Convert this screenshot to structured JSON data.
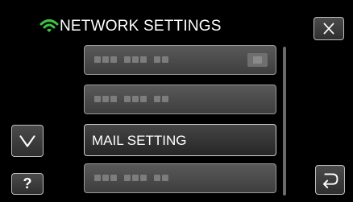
{
  "header": {
    "title": "NETWORK SETTINGS",
    "wifi_icon": "wifi-icon",
    "wifi_color": "#3fc23f"
  },
  "buttons": {
    "close_icon": "close-icon",
    "scroll_down_icon": "chevron-down-icon",
    "help_label": "?",
    "back_icon": "return-icon"
  },
  "list": {
    "items": [
      {
        "label": "",
        "obscured": true,
        "has_chip": true
      },
      {
        "label": "",
        "obscured": true
      },
      {
        "label": "MAIL SETTING",
        "obscured": false
      },
      {
        "label": "",
        "obscured": true
      }
    ]
  }
}
